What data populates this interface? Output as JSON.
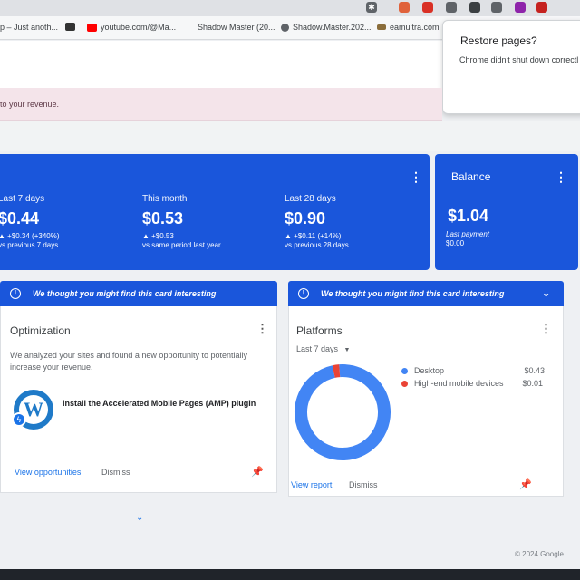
{
  "browser": {
    "bookmarks": [
      {
        "label": "p – Just anoth...",
        "icon": "page-icon"
      },
      {
        "label": "youtube.com/@Ma...",
        "icon": "youtube-icon"
      },
      {
        "label": "Shadow Master (20...",
        "icon": "page-icon"
      },
      {
        "label": "Shadow.Master.202...",
        "icon": "globe-icon"
      },
      {
        "label": "eamultra.com",
        "icon": "site-icon"
      }
    ],
    "restore_popup": {
      "title": "Restore pages?",
      "body": "Chrome didn't shut down correctl"
    }
  },
  "alert": {
    "text": "to your revenue."
  },
  "earnings": {
    "stats": [
      {
        "label": "Last 7 days",
        "value": "$0.44",
        "change": "▲ +$0.34 (+340%)",
        "comparison": "vs previous 7 days"
      },
      {
        "label": "This month",
        "value": "$0.53",
        "change": "▲ +$0.53",
        "comparison": "vs same period last year"
      },
      {
        "label": "Last 28 days",
        "value": "$0.90",
        "change": "▲ +$0.11 (+14%)",
        "comparison": "vs previous 28 days"
      }
    ],
    "balance": {
      "title": "Balance",
      "value": "$1.04",
      "last_payment_label": "Last payment",
      "last_payment_value": "$0.00"
    }
  },
  "banners": {
    "left": "We thought you might find this card interesting",
    "right": "We thought you might find this card interesting"
  },
  "optimization": {
    "title": "Optimization",
    "description": "We analyzed your sites and found a new opportunity to potentially increase your revenue.",
    "plugin": "Install the Accelerated Mobile Pages (AMP) plugin",
    "view_link": "View opportunities",
    "dismiss": "Dismiss"
  },
  "platforms": {
    "title": "Platforms",
    "range": "Last 7 days",
    "legend": [
      {
        "name": "Desktop",
        "value": "$0.43",
        "color": "#4285f4"
      },
      {
        "name": "High-end mobile devices",
        "value": "$0.01",
        "color": "#ea4335"
      }
    ],
    "view_link": "View report",
    "dismiss": "Dismiss"
  },
  "chart_data": {
    "type": "pie",
    "categories": [
      "Desktop",
      "High-end mobile devices"
    ],
    "values": [
      0.43,
      0.01
    ],
    "colors": [
      "#4285f4",
      "#ea4335"
    ],
    "title": ""
  },
  "footer": {
    "copyright": "© 2024 Google"
  },
  "colors": {
    "card_blue": "#1a56db",
    "alert_bg": "#f4e4ea"
  }
}
